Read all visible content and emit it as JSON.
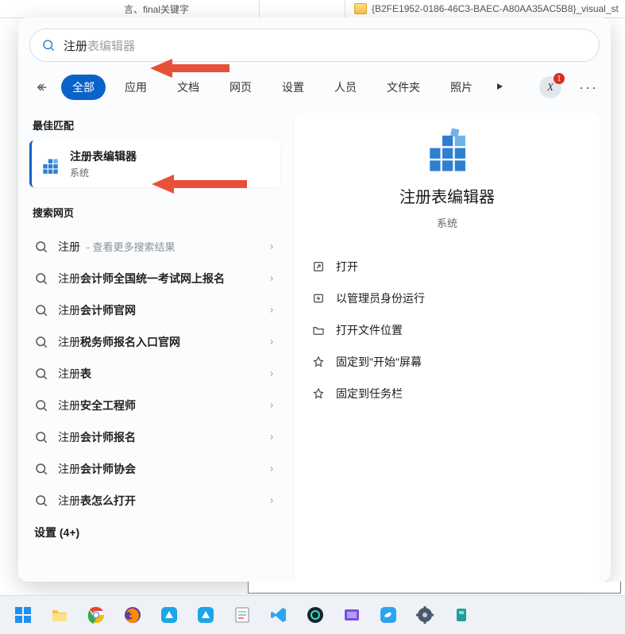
{
  "top": {
    "cell1": "言、final关键字",
    "folder_name": "{B2FE1952-0186-46C3-BAEC-A80AA35AC5B8}_visual_st"
  },
  "search": {
    "typed": "注册",
    "suggestion": "表编辑器"
  },
  "tabs": [
    "全部",
    "应用",
    "文档",
    "网页",
    "设置",
    "人员",
    "文件夹",
    "照片"
  ],
  "avatar_letter": "X",
  "badge": "1",
  "sections": {
    "best": "最佳匹配",
    "web": "搜索网页",
    "settings_more": "设置 (4+)"
  },
  "best": {
    "title": "注册表编辑器",
    "subtitle": "系统"
  },
  "web_items": [
    {
      "pre": "注册",
      "bold": "",
      "hint": "查看更多搜索结果"
    },
    {
      "pre": "注册",
      "bold": "会计师全国统一考试网上报名",
      "hint": ""
    },
    {
      "pre": "注册",
      "bold": "会计师官网",
      "hint": ""
    },
    {
      "pre": "注册",
      "bold": "税务师报名入口官网",
      "hint": ""
    },
    {
      "pre": "注册",
      "bold": "表",
      "hint": ""
    },
    {
      "pre": "注册",
      "bold": "安全工程师",
      "hint": ""
    },
    {
      "pre": "注册",
      "bold": "会计师报名",
      "hint": ""
    },
    {
      "pre": "注册",
      "bold": "会计师协会",
      "hint": ""
    },
    {
      "pre": "注册",
      "bold": "表怎么打开",
      "hint": ""
    }
  ],
  "preview": {
    "title": "注册表编辑器",
    "subtitle": "系统",
    "actions": [
      "打开",
      "以管理员身份运行",
      "打开文件位置",
      "固定到\"开始\"屏幕",
      "固定到任务栏"
    ]
  }
}
